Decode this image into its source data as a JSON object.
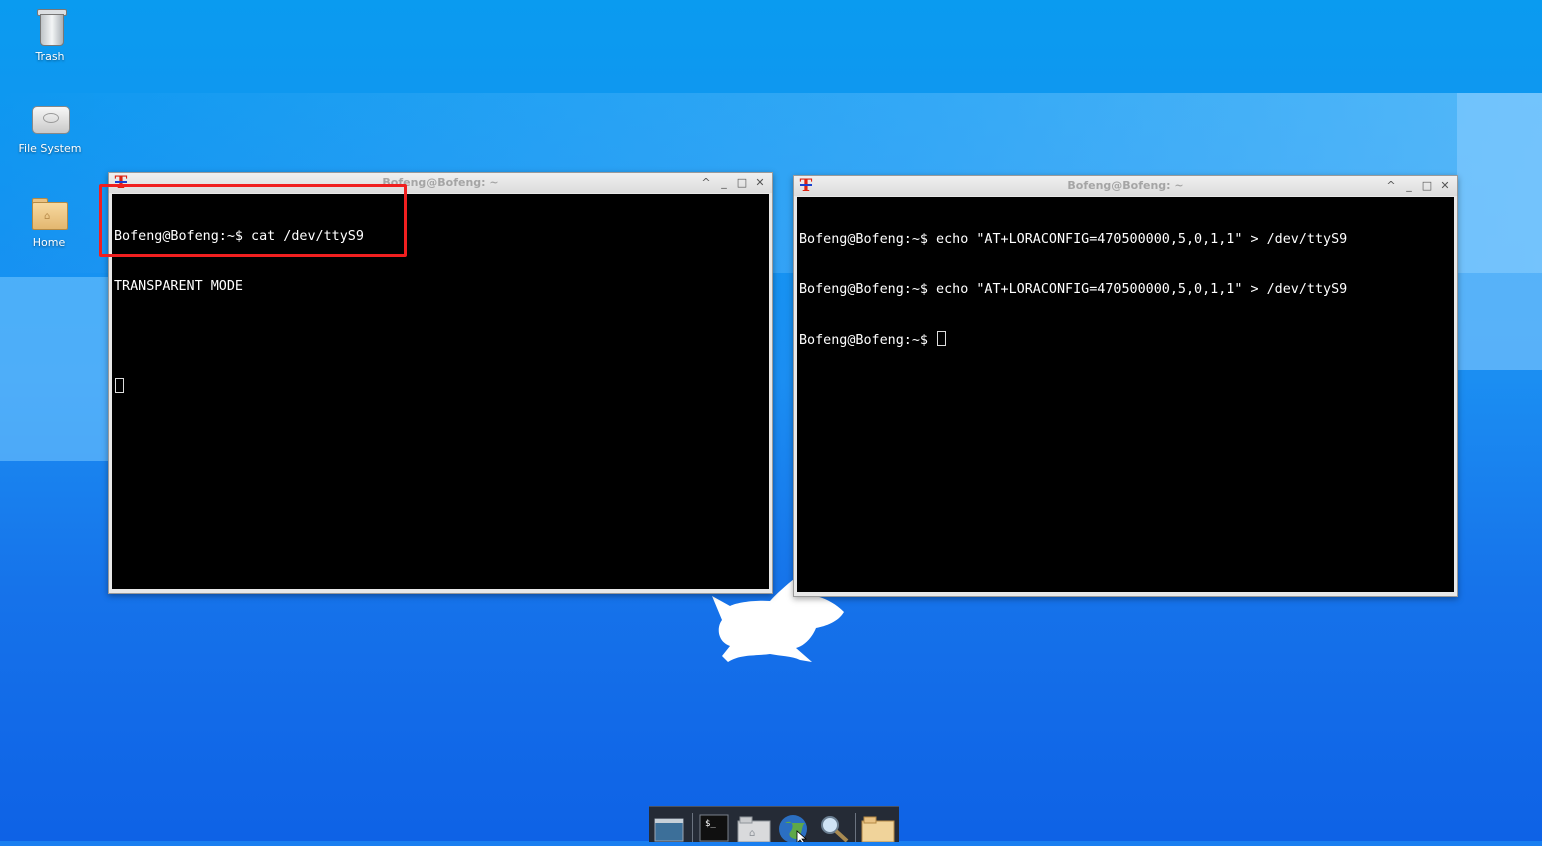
{
  "desktop": {
    "icons": [
      {
        "label": "Trash",
        "icon": "trash-icon"
      },
      {
        "label": "File System",
        "icon": "drive-icon"
      },
      {
        "label": "Home",
        "icon": "home-folder-icon"
      }
    ]
  },
  "windows": {
    "left": {
      "title": "Bofeng@Bofeng: ~",
      "lines": [
        "Bofeng@Bofeng:~$ cat /dev/ttyS9",
        "TRANSPARENT MODE",
        ""
      ]
    },
    "right": {
      "title": "Bofeng@Bofeng: ~",
      "lines": [
        "Bofeng@Bofeng:~$ echo \"AT+LORACONFIG=470500000,5,0,1,1\" > /dev/ttyS9",
        "Bofeng@Bofeng:~$ echo \"AT+LORACONFIG=470500000,5,0,1,1\" > /dev/ttyS9",
        "Bofeng@Bofeng:~$ "
      ]
    },
    "controls": {
      "maximize_up": "^",
      "minimize": "_",
      "restore": "□",
      "close": "✕"
    }
  },
  "dock": {
    "items": [
      "show-desktop-icon",
      "terminal-icon",
      "home-folder-icon",
      "web-browser-icon",
      "search-icon",
      "folder-icon"
    ],
    "terminal_glyph": "$_"
  },
  "colors": {
    "highlight": "#f01f1f",
    "terminal_bg": "#000000",
    "terminal_fg": "#ffffff"
  }
}
